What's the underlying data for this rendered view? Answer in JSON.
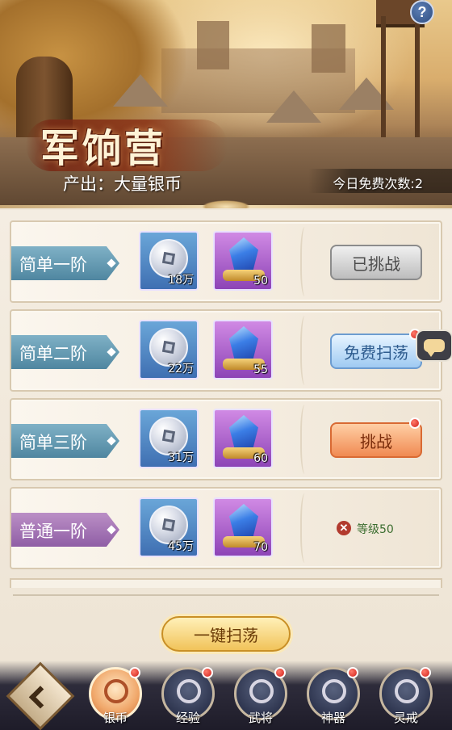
{
  "header": {
    "title": "军饷营",
    "output_text": "产出：大量银币",
    "free_count_text": "今日免费次数:2",
    "help_label": "?"
  },
  "tiers": [
    {
      "name": "简单一阶",
      "coin_qty": "18万",
      "gem_qty": "50",
      "action": "已挑战",
      "state": "done"
    },
    {
      "name": "简单二阶",
      "coin_qty": "22万",
      "gem_qty": "55",
      "action": "免费扫荡",
      "state": "sweep"
    },
    {
      "name": "简单三阶",
      "coin_qty": "31万",
      "gem_qty": "60",
      "action": "挑战",
      "state": "challenge"
    },
    {
      "name": "普通一阶",
      "coin_qty": "45万",
      "gem_qty": "70",
      "action": "等级50",
      "state": "locked"
    }
  ],
  "sweep_all_label": "一键扫荡",
  "nav": {
    "items": [
      {
        "label": "银币",
        "icon": "coin-icon",
        "active": true
      },
      {
        "label": "经验",
        "icon": "experience-icon",
        "active": false
      },
      {
        "label": "武将",
        "icon": "general-icon",
        "active": false
      },
      {
        "label": "神器",
        "icon": "artifact-icon",
        "active": false
      },
      {
        "label": "灵戒",
        "icon": "ring-icon",
        "active": false
      }
    ]
  },
  "colors": {
    "tier_blue": "#4f86a0",
    "tier_purple": "#8f5ea5",
    "challenge_orange": "#f08a52",
    "sweep_blue": "#9fcaf2",
    "done_gray": "#bdbdbd",
    "notify_red": "#d0201a"
  }
}
